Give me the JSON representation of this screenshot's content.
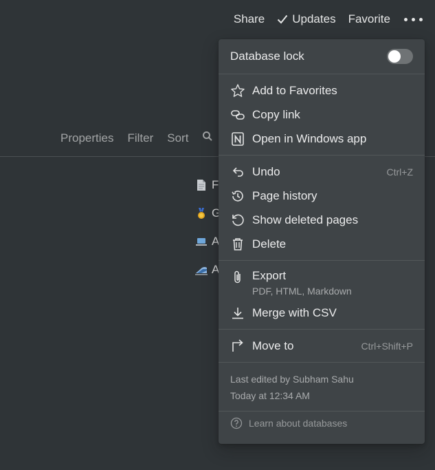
{
  "topbar": {
    "share": "Share",
    "updates": "Updates",
    "favorite": "Favorite"
  },
  "viewbar": {
    "properties": "Properties",
    "filter": "Filter",
    "sort": "Sort"
  },
  "rows": [
    {
      "icon": "page-icon",
      "initial": "F"
    },
    {
      "icon": "medal-icon",
      "initial": "G"
    },
    {
      "icon": "laptop-icon",
      "initial": "A"
    },
    {
      "icon": "train-icon",
      "initial": "A"
    }
  ],
  "menu": {
    "database_lock": "Database lock",
    "database_lock_on": false,
    "add_to_favorites": "Add to Favorites",
    "copy_link": "Copy link",
    "open_in_app": "Open in Windows app",
    "undo": "Undo",
    "undo_shortcut": "Ctrl+Z",
    "page_history": "Page history",
    "show_deleted": "Show deleted pages",
    "delete": "Delete",
    "export": "Export",
    "export_sub": "PDF, HTML, Markdown",
    "merge_csv": "Merge with CSV",
    "move_to": "Move to",
    "move_to_shortcut": "Ctrl+Shift+P",
    "last_edited": "Last edited by Subham Sahu",
    "edited_time": "Today at 12:34 AM",
    "learn": "Learn about databases"
  }
}
